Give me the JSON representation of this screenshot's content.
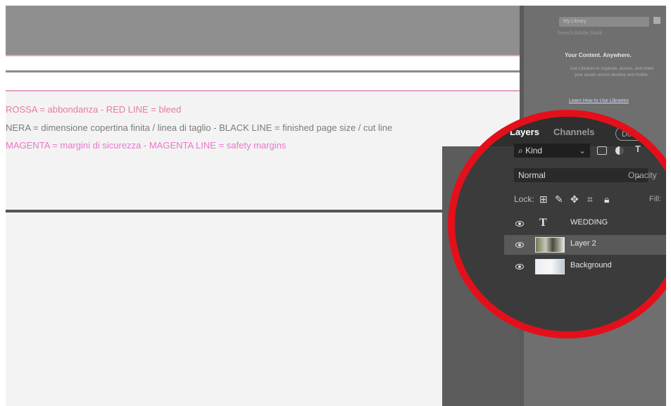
{
  "document": {
    "notes": [
      {
        "text": "ROSSA = abbondanza - RED LINE = bleed",
        "color": "#e879a8"
      },
      {
        "text": "NERA = dimensione copertina finita / linea di taglio - BLACK LINE = finished page size / cut line",
        "color": "#7b7b7b"
      },
      {
        "text": "MAGENTA = margini di sicurezza - MAGENTA LINE = safety margins",
        "color": "#e879c8"
      }
    ]
  },
  "libraries": {
    "library_select": "My Library",
    "search_placeholder": "Search Adobe Stock",
    "heading": "Your Content. Anywhere.",
    "body": "Use Libraries to organize, access, and share your assets across desktop and mobile.",
    "link": "Learn How to Use Libraries"
  },
  "layers_panel": {
    "tabs": [
      {
        "label": "Layers",
        "active": true
      },
      {
        "label": "Channels",
        "active": false
      }
    ],
    "pill_label": "Document",
    "filter_label": "Kind",
    "blend_mode": "Normal",
    "opacity_label": "Opacity",
    "lock_label": "Lock:",
    "fill_label": "Fill:",
    "layers": [
      {
        "name": "WEDDING",
        "type": "text",
        "visible": true,
        "selected": false
      },
      {
        "name": "Layer 2",
        "type": "image",
        "visible": true,
        "selected": true
      },
      {
        "name": "Background",
        "type": "image",
        "visible": true,
        "selected": false
      }
    ]
  },
  "colors": {
    "highlight_ring": "#e3101b",
    "bleed_line": "#e6a0c8"
  }
}
